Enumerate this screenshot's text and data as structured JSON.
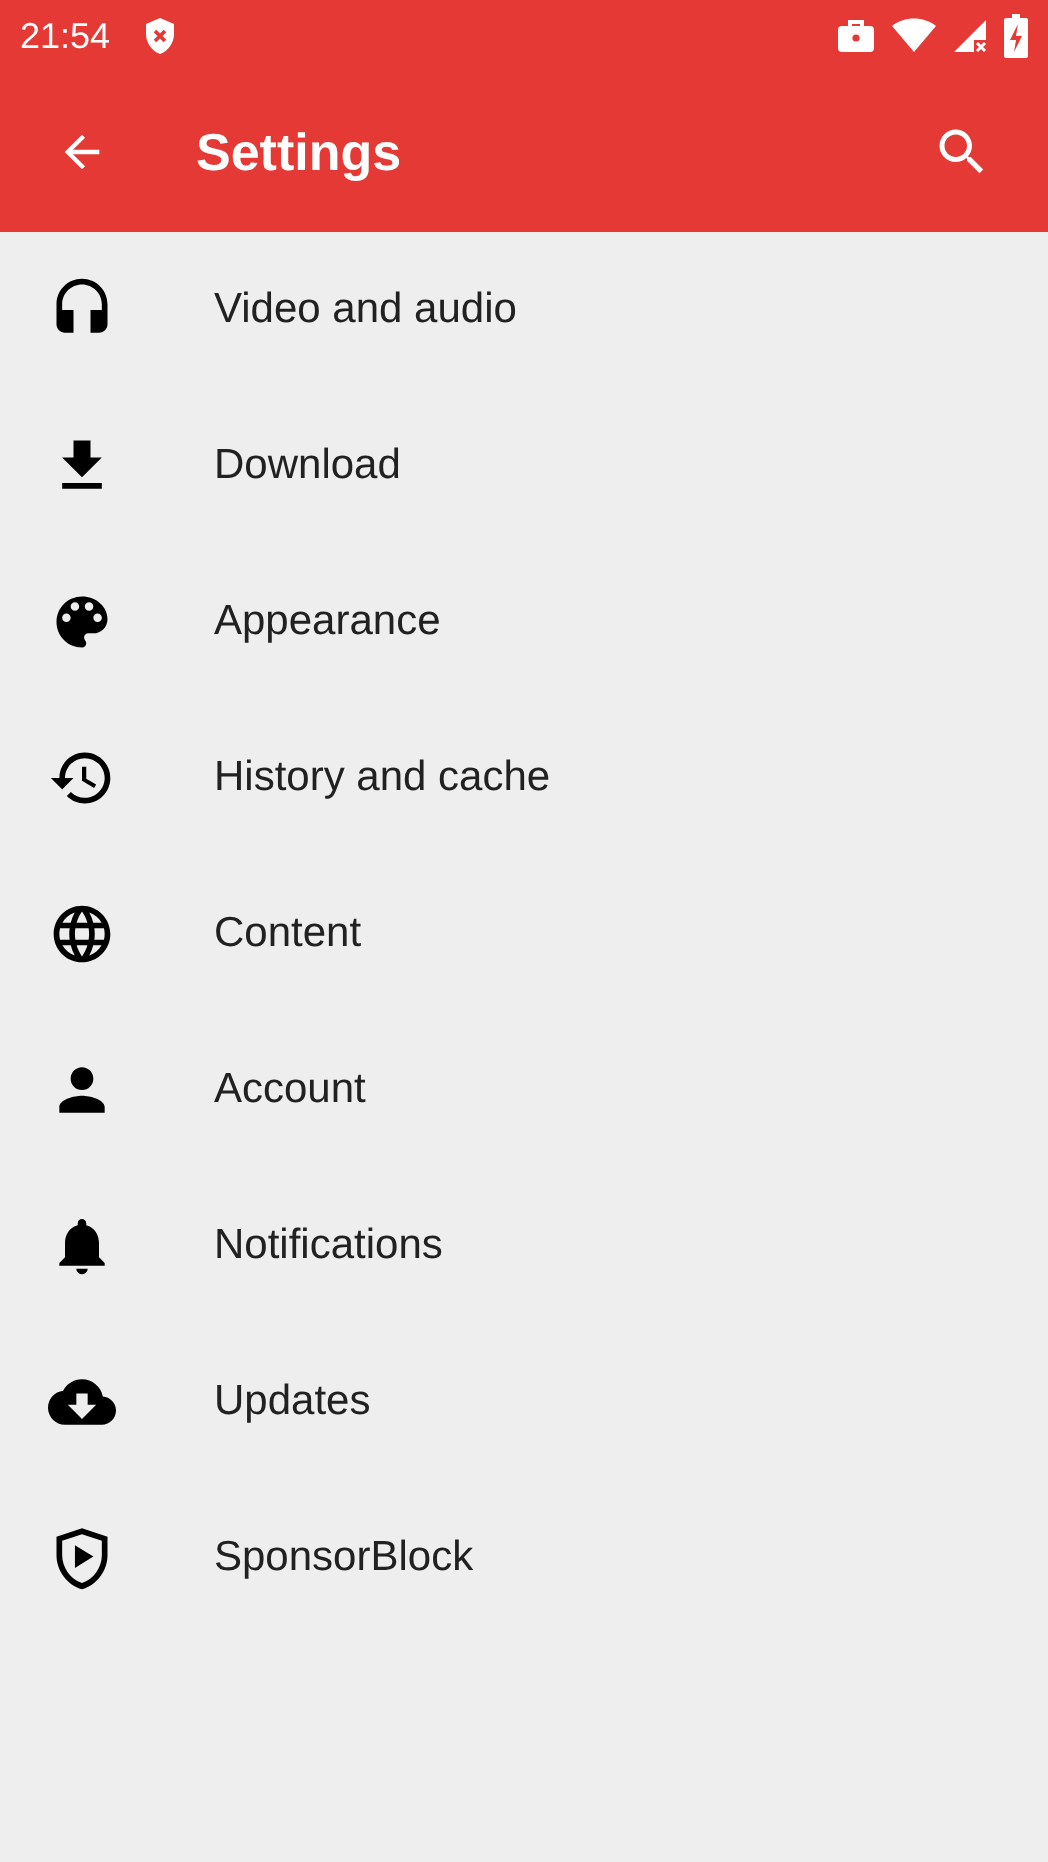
{
  "status_bar": {
    "time": "21:54"
  },
  "app_bar": {
    "title": "Settings"
  },
  "items": [
    {
      "label": "Video and audio"
    },
    {
      "label": "Download"
    },
    {
      "label": "Appearance"
    },
    {
      "label": "History and cache"
    },
    {
      "label": "Content"
    },
    {
      "label": "Account"
    },
    {
      "label": "Notifications"
    },
    {
      "label": "Updates"
    },
    {
      "label": "SponsorBlock"
    }
  ]
}
